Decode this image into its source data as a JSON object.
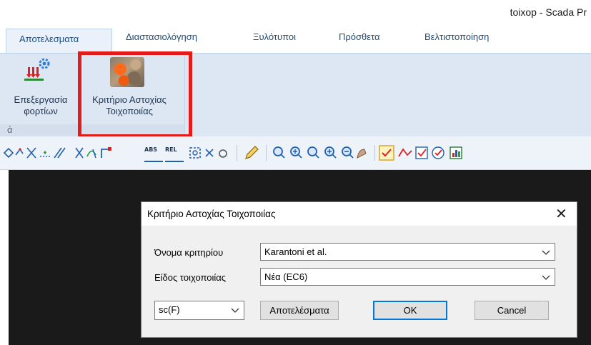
{
  "window": {
    "title": "toixop - Scada Pr"
  },
  "ribbon": {
    "tabs": [
      {
        "label": "Αποτελεσματα",
        "active": true
      },
      {
        "label": "Διαστασιολόγηση",
        "active": false
      },
      {
        "label": "Ξυλότυποι",
        "active": false
      },
      {
        "label": "Πρόσθετα",
        "active": false
      },
      {
        "label": "Βελτιστοποίηση",
        "active": false
      }
    ],
    "buttons": {
      "loads_line1": "Επεξεργασία",
      "loads_line2": "φορτίων",
      "criterion_line1": "Κριτήριο Αστοχίας",
      "criterion_line2": "Τοιχοποιίας"
    },
    "group_label": "ά",
    "highlight_color": "#e31b1b"
  },
  "toolbar": {
    "icons": [
      "draw-tools-icon",
      "snap-tools-icon",
      "abs-icon",
      "rel-icon",
      "pencil-icon",
      "zoom-window-icon",
      "zoom-all-icon",
      "zoom-previous-icon",
      "zoom-in-icon",
      "zoom-out-icon",
      "pan-icon",
      "checkbox-icon",
      "polyline-icon",
      "check-icon",
      "settings-icon",
      "chart-icon"
    ],
    "abs_label": "ABS",
    "rel_label": "REL"
  },
  "dialog": {
    "title": "Κριτήριο Αστοχίας Τοιχοποιίας",
    "close_glyph": "✕",
    "criterion_label": "Όνομα κριτηρίου",
    "criterion_value": "Karantoni et al.",
    "masonry_label": "Είδος τοιχοποιίας",
    "masonry_value": "Νέα (EC6)",
    "function_value": "sc(F)",
    "results_button": "Αποτελέσματα",
    "ok_button": "OK",
    "cancel_button": "Cancel"
  }
}
